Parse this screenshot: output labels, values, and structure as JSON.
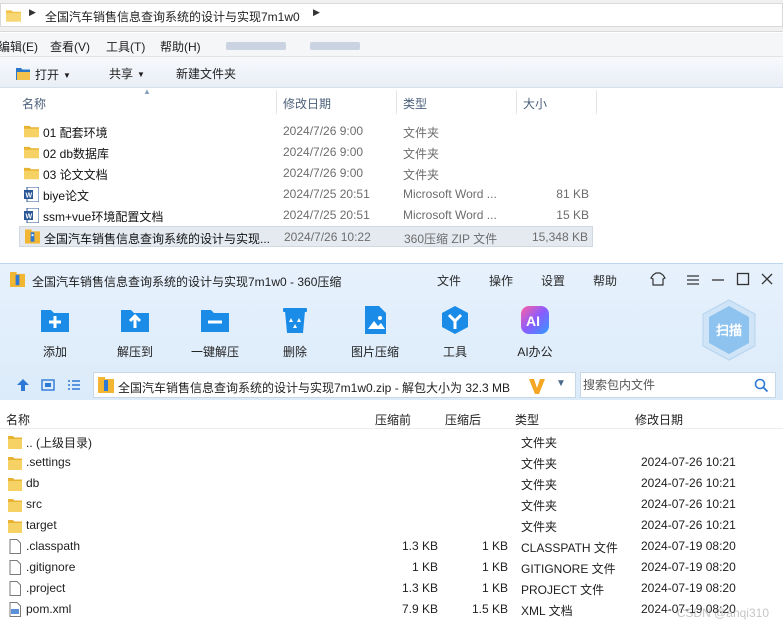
{
  "explorer": {
    "breadcrumb": "全国汽车销售信息查询系统的设计与实现7m1w0",
    "menu": [
      "编辑(E)",
      "查看(V)",
      "工具(T)",
      "帮助(H)"
    ],
    "toolbar": {
      "open": "打开",
      "share": "共享",
      "new_folder": "新建文件夹"
    },
    "columns": {
      "name": "名称",
      "modified": "修改日期",
      "type": "类型",
      "size": "大小"
    },
    "files": [
      {
        "name": "01 配套环境",
        "modified": "2024/7/26 9:00",
        "type": "文件夹",
        "size": "",
        "icon": "folder-icon"
      },
      {
        "name": "02 db数据库",
        "modified": "2024/7/26 9:00",
        "type": "文件夹",
        "size": "",
        "icon": "folder-icon"
      },
      {
        "name": "03 论文文档",
        "modified": "2024/7/26 9:00",
        "type": "文件夹",
        "size": "",
        "icon": "folder-icon"
      },
      {
        "name": "biye论文",
        "modified": "2024/7/25 20:51",
        "type": "Microsoft Word ...",
        "size": "81 KB",
        "icon": "word-icon"
      },
      {
        "name": "ssm+vue环境配置文档",
        "modified": "2024/7/25 20:51",
        "type": "Microsoft Word ...",
        "size": "15 KB",
        "icon": "word-icon"
      },
      {
        "name": "全国汽车销售信息查询系统的设计与实现...",
        "modified": "2024/7/26 10:22",
        "type": "360压缩 ZIP 文件",
        "size": "15,348 KB",
        "icon": "zip-icon"
      }
    ]
  },
  "zip": {
    "title": "全国汽车销售信息查询系统的设计与实现7m1w0 - 360压缩",
    "menu": [
      "文件",
      "操作",
      "设置",
      "帮助"
    ],
    "tools": [
      {
        "label": "添加",
        "icon": "add-icon"
      },
      {
        "label": "解压到",
        "icon": "extract-to-icon"
      },
      {
        "label": "一键解压",
        "icon": "one-click-extract-icon"
      },
      {
        "label": "删除",
        "icon": "delete-icon"
      },
      {
        "label": "图片压缩",
        "icon": "image-compress-icon"
      },
      {
        "label": "工具",
        "icon": "tools-icon"
      },
      {
        "label": "AI办公",
        "icon": "ai-office-icon"
      }
    ],
    "scan": "扫描",
    "path": "全国汽车销售信息查询系统的设计与实现7m1w0.zip - 解包大小为 32.3 MB",
    "search_placeholder": "搜索包内文件",
    "columns": {
      "name": "名称",
      "compressed": "压缩前",
      "packed": "压缩后",
      "type": "类型",
      "modified": "修改日期"
    },
    "files": [
      {
        "name": ".. (上级目录)",
        "compressed": "",
        "packed": "",
        "type": "文件夹",
        "modified": "",
        "icon": "folder-icon"
      },
      {
        "name": ".settings",
        "compressed": "",
        "packed": "",
        "type": "文件夹",
        "modified": "2024-07-26 10:21",
        "icon": "folder-icon"
      },
      {
        "name": "db",
        "compressed": "",
        "packed": "",
        "type": "文件夹",
        "modified": "2024-07-26 10:21",
        "icon": "folder-icon"
      },
      {
        "name": "src",
        "compressed": "",
        "packed": "",
        "type": "文件夹",
        "modified": "2024-07-26 10:21",
        "icon": "folder-icon"
      },
      {
        "name": "target",
        "compressed": "",
        "packed": "",
        "type": "文件夹",
        "modified": "2024-07-26 10:21",
        "icon": "folder-icon"
      },
      {
        "name": ".classpath",
        "compressed": "1.3 KB",
        "packed": "1 KB",
        "type": "CLASSPATH 文件",
        "modified": "2024-07-19 08:20",
        "icon": "file-icon"
      },
      {
        "name": ".gitignore",
        "compressed": "1 KB",
        "packed": "1 KB",
        "type": "GITIGNORE 文件",
        "modified": "2024-07-19 08:20",
        "icon": "file-icon"
      },
      {
        "name": ".project",
        "compressed": "1.3 KB",
        "packed": "1 KB",
        "type": "PROJECT 文件",
        "modified": "2024-07-19 08:20",
        "icon": "file-icon"
      },
      {
        "name": "pom.xml",
        "compressed": "7.9 KB",
        "packed": "1.5 KB",
        "type": "XML 文档",
        "modified": "2024-07-19 08:20",
        "icon": "xml-file-icon"
      }
    ]
  },
  "watermark": "CSDN @anqi310",
  "colors": {
    "accent_blue": "#1a8ce8",
    "folder_yellow": "#f2c34a",
    "selection": "#e5eaf1"
  }
}
